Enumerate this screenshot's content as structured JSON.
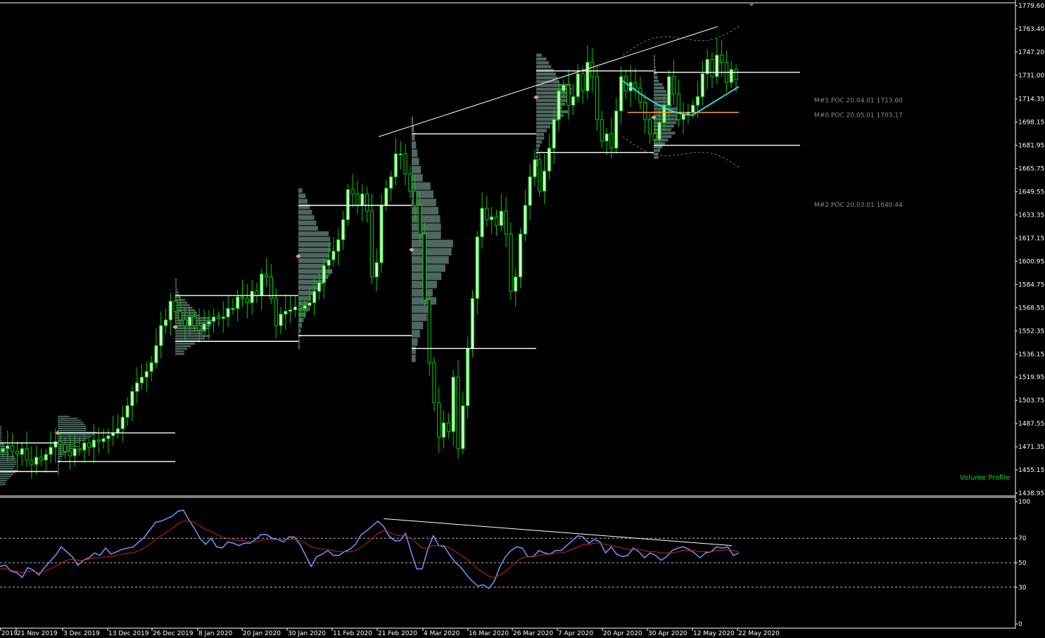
{
  "colors": {
    "background": "#000000",
    "bull_candle": "#c8ffc8",
    "bear_candle": "#00cc00",
    "wick": "#00cc00",
    "volume_bar": "#4f6661",
    "value_area_line": "#ffffff",
    "axis_text": "#ffffff",
    "rsi_line": "#6f8cf0",
    "rsi_ma_line": "#d02020",
    "ema_line": "#33d6d6",
    "poc_line": "#ff9a2e",
    "label_grey": "#8a8a8a",
    "label_green": "#00e000"
  },
  "chart_data": [
    {
      "type": "candlestick",
      "panel": "main",
      "title": "",
      "ylim": [
        1438.95,
        1779.6
      ],
      "y_ticks": [
        "1779.60",
        "1763.40",
        "1747.20",
        "1731.00",
        "1714.35",
        "1698.15",
        "1681.95",
        "1665.75",
        "1649.55",
        "1633.35",
        "1617.15",
        "1600.95",
        "1584.75",
        "1568.55",
        "1552.35",
        "1536.15",
        "1519.95",
        "1503.75",
        "1487.55",
        "1471.35",
        "1455.15",
        "1438.95"
      ],
      "x_ticks": [
        "2019",
        "21 Nov 2019",
        "3 Dec 2019",
        "13 Dec 2019",
        "26 Dec 2019",
        "8 Jan 2020",
        "20 Jan 2020",
        "30 Jan 2020",
        "11 Feb 2020",
        "21 Feb 2020",
        "4 Mar 2020",
        "16 Mar 2020",
        "26 Mar 2020",
        "7 Apr 2020",
        "20 Apr 2020",
        "30 Apr 2020",
        "12 May 2020",
        "22 May 2020"
      ],
      "closes": [
        1470,
        1472,
        1468,
        1466,
        1470,
        1462,
        1459,
        1464,
        1462,
        1466,
        1471,
        1475,
        1473,
        1468,
        1465,
        1470,
        1469,
        1474,
        1471,
        1476,
        1475,
        1477,
        1479,
        1481,
        1484,
        1492,
        1500,
        1510,
        1516,
        1520,
        1524,
        1530,
        1542,
        1556,
        1560,
        1573,
        1566,
        1560,
        1556,
        1562,
        1556,
        1553,
        1557,
        1559,
        1562,
        1561,
        1562,
        1568,
        1568,
        1576,
        1575,
        1572,
        1580,
        1577,
        1592,
        1590,
        1575,
        1556,
        1564,
        1566,
        1567,
        1569,
        1568,
        1570,
        1572,
        1580,
        1586,
        1598,
        1602,
        1608,
        1616,
        1630,
        1651,
        1648,
        1640,
        1648,
        1636,
        1590,
        1600,
        1640,
        1652,
        1660,
        1676,
        1676,
        1662,
        1650,
        1640,
        1620,
        1574,
        1530,
        1502,
        1478,
        1488,
        1482,
        1520,
        1470,
        1500,
        1540,
        1575,
        1618,
        1638,
        1630,
        1632,
        1626,
        1636,
        1620,
        1580,
        1590,
        1620,
        1640,
        1660,
        1672,
        1650,
        1664,
        1680,
        1700,
        1720,
        1724,
        1710,
        1716,
        1732,
        1720,
        1740,
        1730,
        1700,
        1685,
        1690,
        1680,
        1706,
        1730,
        1720,
        1726,
        1722,
        1712,
        1700,
        1690,
        1686,
        1698,
        1710,
        1730,
        1718,
        1700,
        1704,
        1705,
        1710,
        1716,
        1732,
        1742,
        1730,
        1745,
        1740,
        1726,
        1735,
        1728
      ],
      "value_area_lines": [
        {
          "from": "2019",
          "to": "3 Dec 2019",
          "high": 1474,
          "low": 1454
        },
        {
          "from": "3 Dec 2019",
          "to": "26 Dec 2019",
          "high": 1481,
          "low": 1461
        },
        {
          "from": "26 Dec 2019",
          "to": "30 Jan 2020",
          "high": 1577,
          "low": 1545
        },
        {
          "from": "30 Jan 2020",
          "to": "21 Feb 2020",
          "high": 1640,
          "low": 1549
        },
        {
          "from": "21 Feb 2020",
          "to": "26 Mar 2020",
          "high": 1690,
          "low": 1540
        },
        {
          "from": "26 Mar 2020",
          "to": "30 Apr 2020",
          "high": 1734,
          "low": 1677
        },
        {
          "from": "30 Apr 2020",
          "to": "22 May 2020",
          "high": 1733,
          "low": 1682
        }
      ],
      "poc_labels": [
        {
          "text": "M#1.POC 20.04.01 1713.60",
          "price": 1713.6
        },
        {
          "text": "M#0.POC 20.05.01 1703.17",
          "price": 1703.17
        },
        {
          "text": "M#2.POC 20.03.01 1640.44",
          "price": 1640.44
        }
      ],
      "indicator_label": "Volume Profile"
    },
    {
      "type": "line",
      "panel": "rsi",
      "title": "",
      "ylim": [
        0,
        100
      ],
      "y_ticks": [
        "100",
        "70",
        "50",
        "30",
        "0"
      ],
      "levels": [
        70,
        50,
        30
      ],
      "series": [
        {
          "values": [
            47,
            48,
            43,
            42,
            38,
            46,
            44,
            40,
            46,
            51,
            56,
            63,
            59,
            55,
            48,
            52,
            54,
            58,
            56,
            62,
            57,
            59,
            61,
            62,
            63,
            67,
            71,
            77,
            83,
            84,
            86,
            88,
            92,
            93,
            85,
            78,
            70,
            65,
            70,
            63,
            62,
            67,
            66,
            64,
            66,
            66,
            69,
            73,
            73,
            70,
            69,
            67,
            71,
            71,
            65,
            56,
            47,
            55,
            57,
            60,
            56,
            56,
            59,
            61,
            65,
            73,
            76,
            80,
            84,
            80,
            72,
            68,
            68,
            74,
            59,
            45,
            45,
            61,
            72,
            64,
            63,
            56,
            50,
            46,
            40,
            35,
            31,
            32,
            29,
            35,
            47,
            55,
            60,
            63,
            62,
            55,
            55,
            60,
            58,
            57,
            60,
            60,
            64,
            68,
            72,
            71,
            66,
            69,
            67,
            58,
            63,
            57,
            55,
            56,
            62,
            59,
            54,
            58,
            56,
            52,
            55,
            60,
            62,
            63,
            61,
            58,
            54,
            58,
            59,
            63,
            62,
            63,
            56,
            58
          ]
        },
        {
          "values": [
            45,
            45,
            44,
            43,
            42,
            43,
            43,
            42,
            43,
            45,
            47,
            50,
            52,
            53,
            52,
            52,
            53,
            54,
            54,
            55,
            55,
            56,
            57,
            58,
            58,
            60,
            62,
            65,
            69,
            72,
            75,
            78,
            82,
            84,
            84,
            83,
            80,
            77,
            76,
            73,
            71,
            70,
            69,
            68,
            68,
            67,
            67,
            68,
            69,
            69,
            69,
            69,
            69,
            69,
            68,
            66,
            63,
            62,
            61,
            61,
            60,
            59,
            59,
            59,
            60,
            63,
            66,
            70,
            74,
            76,
            75,
            73,
            72,
            72,
            70,
            66,
            62,
            62,
            64,
            64,
            64,
            62,
            59,
            56,
            53,
            49,
            45,
            42,
            39,
            38,
            40,
            43,
            47,
            51,
            54,
            55,
            55,
            56,
            57,
            57,
            58,
            58,
            59,
            61,
            63,
            65,
            65,
            66,
            66,
            65,
            64,
            63,
            62,
            61,
            61,
            61,
            60,
            59,
            59,
            58,
            58,
            58,
            59,
            60,
            60,
            60,
            59,
            59,
            59,
            60,
            60,
            61,
            60,
            59
          ]
        }
      ],
      "trendline_label": ""
    }
  ]
}
